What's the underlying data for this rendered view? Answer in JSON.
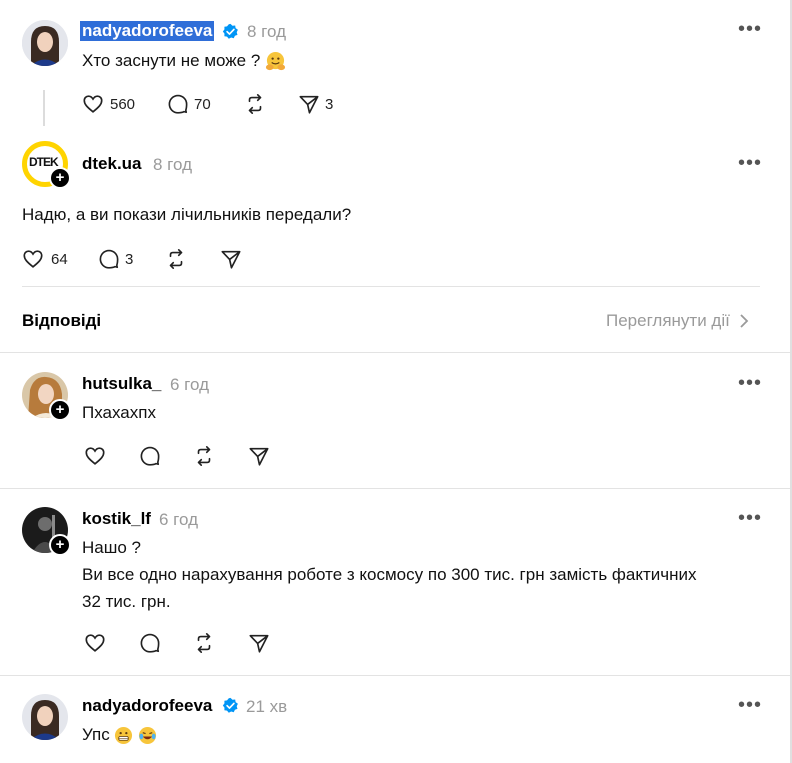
{
  "post": {
    "username": "nadyadorofeeva",
    "time": "8 год",
    "text": "Хто заснути не може ?",
    "likes": "560",
    "comments": "70",
    "shares": "3"
  },
  "reply_main": {
    "avatar_text": "DTEK",
    "username": "dtek.ua",
    "time": "8 год",
    "text": "Надю, а ви покази лічильників передали?",
    "likes": "64",
    "comments": "3"
  },
  "section": {
    "title": "Відповіді",
    "view_activity": "Переглянути дії"
  },
  "replies": [
    {
      "username": "hutsulka_",
      "time": "6 год",
      "text": "Пхахахпх"
    },
    {
      "username": "kostik_lf",
      "time": "6 год",
      "line1": "Нашо ?",
      "line2": "Ви все одно нарахування роботе з космосу по 300 тис. грн замість фактичних",
      "line3": "32 тис. грн."
    },
    {
      "username": "nadyadorofeeva",
      "time": "21 хв",
      "text": "Упс"
    }
  ],
  "colors": {
    "verified": "#0095f6",
    "dtek_yellow": "#ffd400",
    "highlight": "#2f6ed8"
  }
}
